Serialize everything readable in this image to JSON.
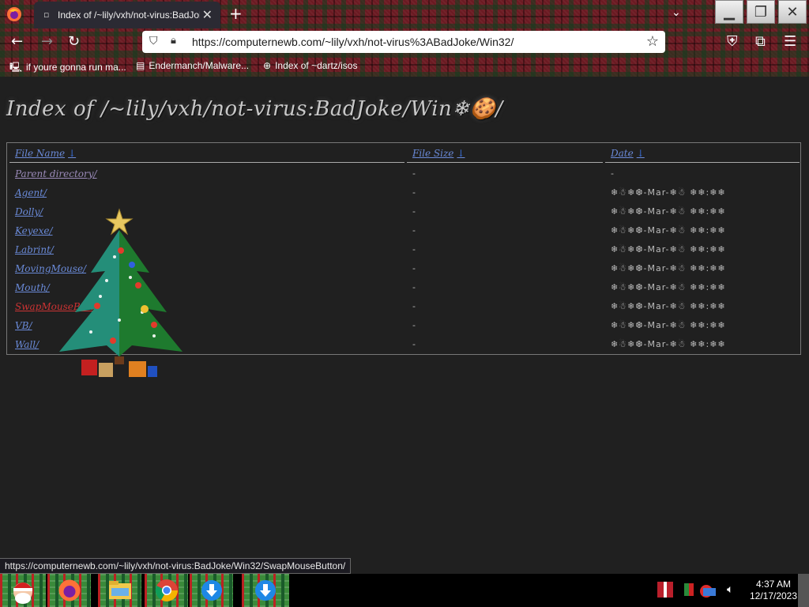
{
  "browser": {
    "tab_title": "Index of /~lily/vxh/not-virus:BadJoke/Win32/",
    "tab_close": "✕",
    "new_tab": "+",
    "url": "https://computernewb.com/~lily/vxh/not-virus%3ABadJoke/Win32/",
    "status_url": "https://computernewb.com/~lily/vxh/not-virus:BadJoke/Win32/SwapMouseButton/"
  },
  "bookmarks": [
    {
      "label": "if youre gonna run ma...",
      "icon": "computer-icon"
    },
    {
      "label": "Endermanch/Malware...",
      "icon": "page-icon"
    },
    {
      "label": "Index of ~dartz/isos",
      "icon": "globe-icon"
    }
  ],
  "page": {
    "title": "Index of /~lily/vxh/not-virus:BadJoke/Win❄🍪/",
    "columns": {
      "name": "File Name",
      "size": "File Size",
      "date": "Date",
      "sort_arrow": "↓"
    },
    "rows": [
      {
        "name": "Parent directory/",
        "size": "-",
        "date": "-"
      },
      {
        "name": "Agent/",
        "size": "-",
        "date": "❄☃❄❆-Mar-❄☃ ❄❄:❄❄"
      },
      {
        "name": "Dolly/",
        "size": "-",
        "date": "❄☃❄❆-Mar-❄☃ ❄❄:❄❄"
      },
      {
        "name": "Keyexe/",
        "size": "-",
        "date": "❄☃❄❆-Mar-❄☃ ❄❄:❄❄"
      },
      {
        "name": "Labrint/",
        "size": "-",
        "date": "❄☃❄❆-Mar-❄☃ ❄❄:❄❄"
      },
      {
        "name": "MovingMouse/",
        "size": "-",
        "date": "❄☃❄❆-Mar-❄☃ ❄❄:❄❄"
      },
      {
        "name": "Mouth/",
        "size": "-",
        "date": "❄☃❄❆-Mar-❄☃ ❄❄:❄❄"
      },
      {
        "name": "SwapMouseButton/",
        "size": "-",
        "date": "❄☃❄❆-Mar-❄☃ ❄❄:❄❄"
      },
      {
        "name": "VB/",
        "size": "-",
        "date": "❄☃❄❆-Mar-❄☃ ❄❄:❄❄"
      },
      {
        "name": "Wall/",
        "size": "-",
        "date": "❄☃❄❆-Mar-❄☃ ❄❄:❄❄"
      }
    ]
  },
  "taskbar": {
    "time": "4:37 AM",
    "date": "12/17/2023"
  },
  "colors": {
    "link": "#6a8ad8",
    "hover_link": "#cc3333",
    "background": "#202020"
  }
}
